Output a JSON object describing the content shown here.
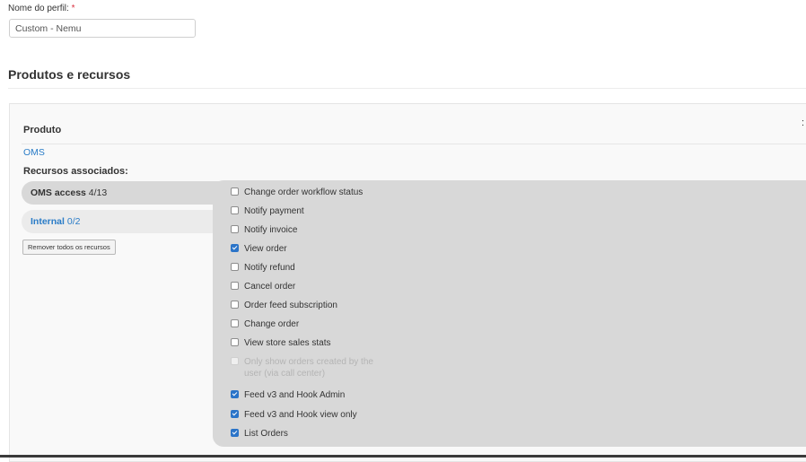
{
  "profile": {
    "name_label": "Nome do perfil:",
    "required_mark": "*",
    "name_value": "Custom - Nemu"
  },
  "section": {
    "title": "Produtos e recursos"
  },
  "product_panel": {
    "close_mark": ":",
    "header": "Produto",
    "product_link": "OMS",
    "resources_label": "Recursos associados:",
    "resource_groups": [
      {
        "name": "OMS access",
        "count": "4/13",
        "expanded": true
      },
      {
        "name": "Internal",
        "count": "0/2",
        "expanded": false
      }
    ],
    "remove_all_button": "Remover todos os recursos"
  },
  "permissions": [
    {
      "label": "Change order workflow status",
      "checked": false,
      "disabled": false
    },
    {
      "label": "Notify payment",
      "checked": false,
      "disabled": false
    },
    {
      "label": "Notify invoice",
      "checked": false,
      "disabled": false
    },
    {
      "label": "View order",
      "checked": true,
      "disabled": false
    },
    {
      "label": "Notify refund",
      "checked": false,
      "disabled": false
    },
    {
      "label": "Cancel order",
      "checked": false,
      "disabled": false
    },
    {
      "label": "Order feed subscription",
      "checked": false,
      "disabled": false
    },
    {
      "label": "Change order",
      "checked": false,
      "disabled": false
    },
    {
      "label": "View store sales stats",
      "checked": false,
      "disabled": false
    },
    {
      "label": "Only show orders created by the",
      "label_line2": "user (via call center)",
      "checked": false,
      "disabled": true
    },
    {
      "label": "Feed v3 and Hook Admin",
      "checked": true,
      "disabled": false
    },
    {
      "label": "Feed v3 and Hook view only",
      "checked": true,
      "disabled": false
    },
    {
      "label": "List Orders",
      "checked": true,
      "disabled": false
    }
  ],
  "colors": {
    "accent": "#2b74c8",
    "link": "#2a7cc7",
    "required": "#d9303e"
  }
}
